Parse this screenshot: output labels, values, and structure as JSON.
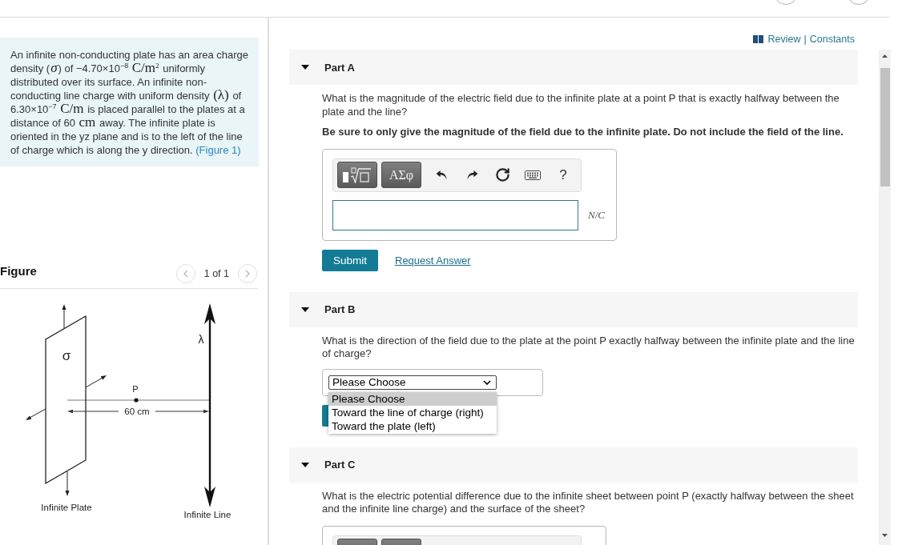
{
  "problem": {
    "segments": [
      {
        "kind": "text",
        "text": "An infinite non-conducting plate has an area charge density ("
      },
      {
        "kind": "math",
        "text": "*σ*"
      },
      {
        "kind": "text",
        "text": ") of −4.70×10$^{−8}$ "
      },
      {
        "kind": "math",
        "text": "C/m$^{2}$"
      },
      {
        "kind": "text",
        "text": " uniformly distributed over its surface. An infinite non-conducting line charge with uniform density "
      },
      {
        "kind": "math",
        "text": "(λ)"
      },
      {
        "kind": "text",
        "text": " of 6.30×10$^{−7}$ "
      },
      {
        "kind": "math",
        "text": "C/m"
      },
      {
        "kind": "text",
        "text": " is placed parallel to the plates at a distance of 60 "
      },
      {
        "kind": "math",
        "text": "cm"
      },
      {
        "kind": "text",
        "text": " away. The infinite plate is oriented in the yz plane and is to the left of the line of charge which is along the y direction. "
      },
      {
        "kind": "link",
        "text": "(Figure 1)"
      }
    ]
  },
  "figure": {
    "title": "Figure",
    "pager": "1 of 1",
    "labels": {
      "plate_charge": "σ",
      "line_charge": "λ",
      "point": "P",
      "distance": "60 cm",
      "plate": "Infinite Plate",
      "line": "Infinite Line"
    }
  },
  "links": {
    "review": "Review",
    "separator": "|",
    "constants": "Constants"
  },
  "parts": [
    {
      "title": "Part A",
      "expanded": true,
      "question": "What is the magnitude of the electric field due to the infinite plate at a point P that is exactly halfway between the plate and the line?",
      "note": "Be sure to only give the magnitude of the field due to the infinite plate. Do not include the field of the line.",
      "answer": {
        "kind": "math_input",
        "toolbar": [
          {
            "kind": "template"
          },
          {
            "kind": "symbols",
            "label": "ΑΣφ"
          },
          {
            "kind": "undo"
          },
          {
            "kind": "redo"
          },
          {
            "kind": "reset"
          },
          {
            "kind": "keyboard"
          },
          {
            "kind": "help",
            "label": "?"
          }
        ],
        "input": {
          "units": "N/C"
        }
      },
      "buttons": [
        {
          "kind": "submit",
          "label": "Submit"
        },
        {
          "kind": "link",
          "label": "Request Answer"
        }
      ]
    },
    {
      "title": "Part B",
      "expanded": true,
      "question": "What is the direction of the field due to the plate at the point P exactly halfway between the infinite plate and the line of charge?",
      "answer": {
        "kind": "dropdown",
        "value": "Please Choose",
        "open": true,
        "options": [
          {
            "label": "Please Choose",
            "selected": true
          },
          {
            "label": "Toward the line of charge (right)",
            "selected": false
          },
          {
            "label": "Toward the plate (left)",
            "selected": false
          }
        ]
      },
      "buttons": [
        {
          "kind": "submit"
        }
      ]
    },
    {
      "title": "Part C",
      "expanded": true,
      "question": "What is the electric potential difference due to the infinite sheet between point P (exactly halfway between the sheet and the infinite line charge) and the surface of the sheet?",
      "answer": {
        "kind": "math_input",
        "toolbar": [
          {
            "kind": "blank"
          },
          {
            "kind": "blank"
          }
        ]
      }
    }
  ]
}
